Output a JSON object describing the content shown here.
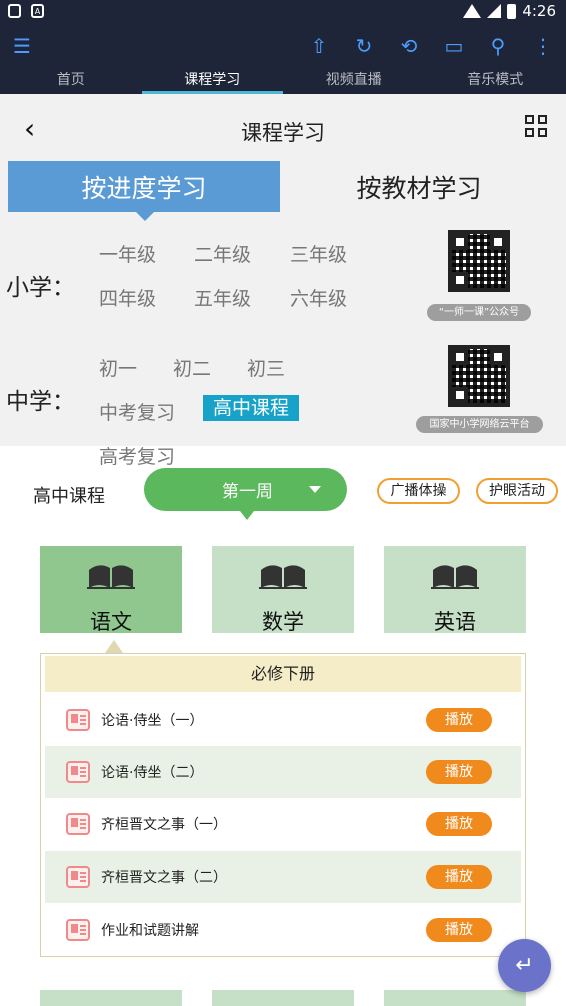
{
  "status_bar": {
    "time": "4:26"
  },
  "app_bar": {
    "icons": [
      "menu-icon",
      "shirt-icon",
      "refresh-icon",
      "rotate-icon",
      "monitor-icon",
      "search-icon",
      "more-icon"
    ]
  },
  "tabs": [
    {
      "label": "首页",
      "active": false
    },
    {
      "label": "课程学习",
      "active": true
    },
    {
      "label": "视频直播",
      "active": false
    },
    {
      "label": "音乐模式",
      "active": false
    }
  ],
  "header": {
    "title": "课程学习"
  },
  "segments": {
    "by_progress": "按进度学习",
    "by_textbook": "按教材学习"
  },
  "primary": {
    "label": "小学：",
    "grades": [
      "一年级",
      "二年级",
      "三年级",
      "四年级",
      "五年级",
      "六年级"
    ],
    "qr_caption": "“一师一课”公众号"
  },
  "middle": {
    "label": "中学：",
    "grades": [
      "初一",
      "初二",
      "初三",
      "中考复习",
      "高中课程",
      "高考复习"
    ],
    "selected": "高中课程",
    "qr_caption": "国家中小学网络云平台"
  },
  "course": {
    "label": "高中课程",
    "week": "第一周",
    "broadcast_btn": "广播体操",
    "eye_btn": "护眼活动"
  },
  "subjects": [
    {
      "name": "语文",
      "selected": true
    },
    {
      "name": "数学",
      "selected": false
    },
    {
      "name": "英语",
      "selected": false
    }
  ],
  "lessons": {
    "header": "必修下册",
    "play_label": "播放",
    "items": [
      {
        "title": "论语·侍坐（一）"
      },
      {
        "title": "论语·侍坐（二）"
      },
      {
        "title": "齐桓晋文之事（一）"
      },
      {
        "title": "齐桓晋文之事（二）"
      },
      {
        "title": "作业和试题讲解"
      }
    ]
  },
  "colors": {
    "app_bar": "#1e2538",
    "accent_blue": "#5b9bd5",
    "selected_grade": "#17a3c9",
    "green": "#5cb85c",
    "play_orange": "#f08a1c",
    "fab": "#6a72c9"
  }
}
